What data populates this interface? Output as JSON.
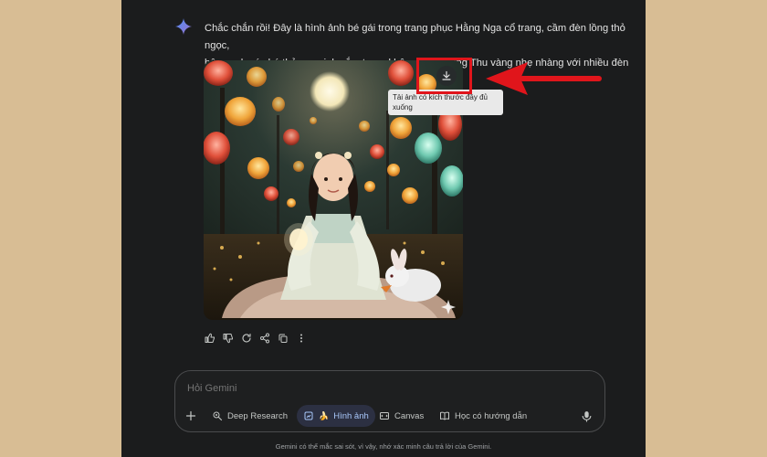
{
  "response": {
    "line1": "Chắc chắn rồi! Đây là hình ảnh bé gái trong trang phục Hằng Nga cổ trang, cầm đèn lồng thỏ ngọc,",
    "line2": "bên cạnh có chú thỏ con xinh xắn, trong không gian Trung Thu vàng nhẹ nhàng với nhiều đèn lồng:"
  },
  "image": {
    "download_tooltip": "Tải ảnh có kích thước đầy đủ xuống"
  },
  "actions": [
    "thumb-up-icon",
    "thumb-down-icon",
    "refresh-icon",
    "share-icon",
    "copy-icon",
    "more-vert-icon"
  ],
  "composer": {
    "placeholder": "Hỏi Gemini",
    "tools": {
      "deep_research": "Deep Research",
      "images": "Hình ảnh",
      "images_emoji": "🍌",
      "canvas": "Canvas",
      "guided_learning": "Học có hướng dẫn"
    }
  },
  "disclaimer": "Gemini có thể mắc sai sót, vì vậy, nhớ xác minh câu trả lời của Gemini.",
  "colors": {
    "background": "#d8bd94",
    "app": "#1b1c1d",
    "highlight": "#e0151b",
    "active_tool": "#a8c7fa"
  }
}
